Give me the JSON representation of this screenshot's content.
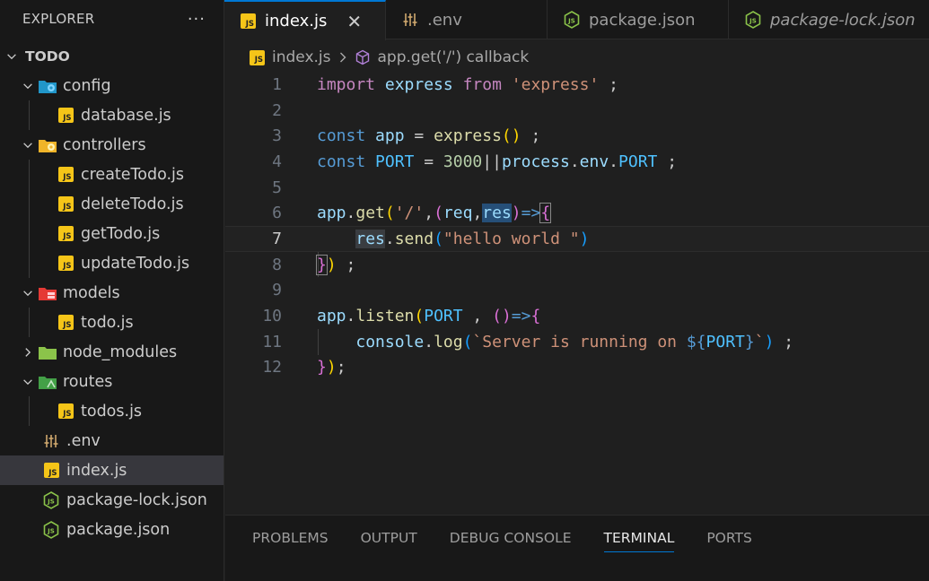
{
  "explorer": {
    "title": "EXPLORER",
    "more": "···",
    "root": "TODO",
    "items": [
      {
        "label": "config"
      },
      {
        "label": "database.js"
      },
      {
        "label": "controllers"
      },
      {
        "label": "createTodo.js"
      },
      {
        "label": "deleteTodo.js"
      },
      {
        "label": "getTodo.js"
      },
      {
        "label": "updateTodo.js"
      },
      {
        "label": "models"
      },
      {
        "label": "todo.js"
      },
      {
        "label": "node_modules"
      },
      {
        "label": "routes"
      },
      {
        "label": "todos.js"
      },
      {
        "label": ".env"
      },
      {
        "label": "index.js"
      },
      {
        "label": "package-lock.json"
      },
      {
        "label": "package.json"
      }
    ]
  },
  "tabs": [
    {
      "label": "index.js",
      "close": "✕"
    },
    {
      "label": ".env"
    },
    {
      "label": "package.json"
    },
    {
      "label": "package-lock.json"
    }
  ],
  "breadcrumb": {
    "file": "index.js",
    "symbol": "app.get('/') callback"
  },
  "editor": {
    "line_numbers": [
      "1",
      "2",
      "3",
      "4",
      "5",
      "6",
      "7",
      "8",
      "9",
      "10",
      "11",
      "12"
    ]
  },
  "panel": {
    "tabs": [
      "PROBLEMS",
      "OUTPUT",
      "DEBUG CONSOLE",
      "TERMINAL",
      "PORTS"
    ]
  },
  "colors": {
    "accent": "#0078d4",
    "js_icon": "#f5c518",
    "node_icon": "#8bc34a"
  }
}
